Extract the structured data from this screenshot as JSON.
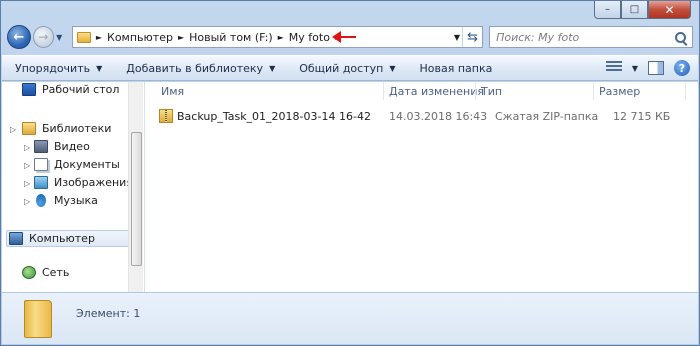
{
  "window": {
    "caption_buttons": {
      "minimize": "–",
      "maximize": "□",
      "close": "✕"
    }
  },
  "navbar": {
    "back_glyph": "←",
    "forward_glyph": "→",
    "history_glyph": "▼",
    "breadcrumbs": [
      "Компьютер",
      "Новый том (F:)",
      "My foto"
    ],
    "separator_glyph": "►",
    "dropdown_glyph": "▼",
    "refresh_glyph": "⇆",
    "search_placeholder": "Поиск: My foto"
  },
  "toolbar": {
    "organize": "Упорядочить",
    "add_to_library": "Добавить в библиотеку",
    "share": "Общий доступ",
    "new_folder": "Новая папка",
    "caret": "▼",
    "help_glyph": "?"
  },
  "sidebar": {
    "desktop": "Рабочий стол",
    "libraries": "Библиотеки",
    "libraries_items": [
      "Видео",
      "Документы",
      "Изображения",
      "Музыка"
    ],
    "computer": "Компьютер",
    "network": "Сеть",
    "expander_glyph": "▷"
  },
  "file_list": {
    "columns": [
      "Имя",
      "Дата изменения",
      "Тип",
      "Размер"
    ],
    "rows": [
      {
        "name": "Backup_Task_01_2018-03-14 16-42",
        "date": "14.03.2018 16:43",
        "type": "Сжатая ZIP-папка",
        "size": "12 715 КБ"
      }
    ]
  },
  "details": {
    "count_label": "Элемент: 1"
  },
  "colors": {
    "annotation_arrow": "#e01212"
  }
}
